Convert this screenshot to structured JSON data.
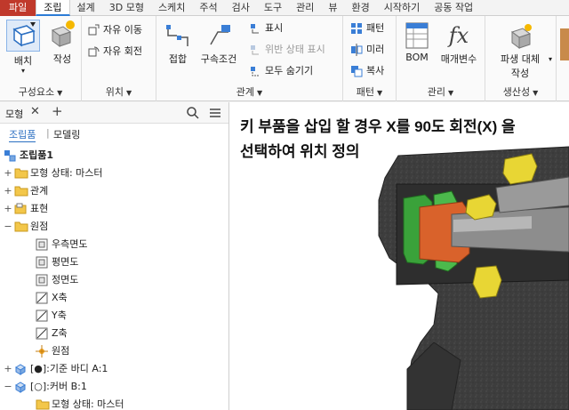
{
  "tabs": [
    "파일",
    "조립",
    "설계",
    "3D 모형",
    "스케치",
    "주석",
    "검사",
    "도구",
    "관리",
    "뷰",
    "환경",
    "시작하기",
    "공동 작업"
  ],
  "active_tab": "조립",
  "ribbon": {
    "component_panel": {
      "title": "구성요소",
      "place": "배치",
      "create": "작성"
    },
    "position_panel": {
      "title": "위치",
      "free_move": "자유 이동",
      "free_rotate": "자유 회전"
    },
    "relationships_panel": {
      "title": "관계",
      "join": "접합",
      "constrain": "구속조건",
      "show": "표시",
      "show_sick": "위반 상태 표시",
      "hide_all": "모두 숨기기"
    },
    "pattern_panel": {
      "title": "패턴",
      "pattern": "패턴",
      "mirror": "미러",
      "copy": "복사"
    },
    "manage_panel": {
      "title": "관리",
      "bom": "BOM",
      "parameters": "매개변수"
    },
    "productivity_panel": {
      "title": "생산성",
      "derived_replace": "파생 대체",
      "create_label": "작성"
    }
  },
  "browser": {
    "title": "모형",
    "tabs": [
      "조립품",
      "모델링"
    ],
    "tree": [
      {
        "label": "조립품1",
        "level": 0,
        "expander": "",
        "icon": "assembly-icon"
      },
      {
        "label": "모형 상태: 마스터",
        "level": 1,
        "expander": "+",
        "icon": "folder-icon"
      },
      {
        "label": "관계",
        "level": 1,
        "expander": "+",
        "icon": "folder-icon"
      },
      {
        "label": "표현",
        "level": 1,
        "expander": "+",
        "icon": "representation-icon"
      },
      {
        "label": "원점",
        "level": 1,
        "expander": "−",
        "icon": "folder-icon"
      },
      {
        "label": "우측면도",
        "level": 2,
        "expander": "",
        "icon": "plane-icon"
      },
      {
        "label": "평면도",
        "level": 2,
        "expander": "",
        "icon": "plane-icon"
      },
      {
        "label": "정면도",
        "level": 2,
        "expander": "",
        "icon": "plane-icon"
      },
      {
        "label": "X축",
        "level": 2,
        "expander": "",
        "icon": "axis-icon"
      },
      {
        "label": "Y축",
        "level": 2,
        "expander": "",
        "icon": "axis-icon"
      },
      {
        "label": "Z축",
        "level": 2,
        "expander": "",
        "icon": "axis-icon"
      },
      {
        "label": "원점",
        "level": 2,
        "expander": "",
        "icon": "point-icon"
      },
      {
        "label": "[●]:기준 바디 A:1",
        "level": 1,
        "expander": "+",
        "icon": "part-icon"
      },
      {
        "label": "[○]:커버 B:1",
        "level": 1,
        "expander": "−",
        "icon": "part-icon"
      },
      {
        "label": "모형 상태: 마스터",
        "level": 2,
        "expander": "",
        "icon": "folder-icon"
      }
    ]
  },
  "viewport": {
    "caption_line1": "키 부품을 삽입 할 경우 X를 90도 회전(X) 을",
    "caption_line2": "선택하여 위치 정의"
  },
  "colors": {
    "file_tab": "#c0392b",
    "accent": "#2b7bd6",
    "green_part": "#3aa23a",
    "orange_part": "#d9622b",
    "yellow_part": "#e8d634",
    "housing": "#3d3d3d"
  }
}
